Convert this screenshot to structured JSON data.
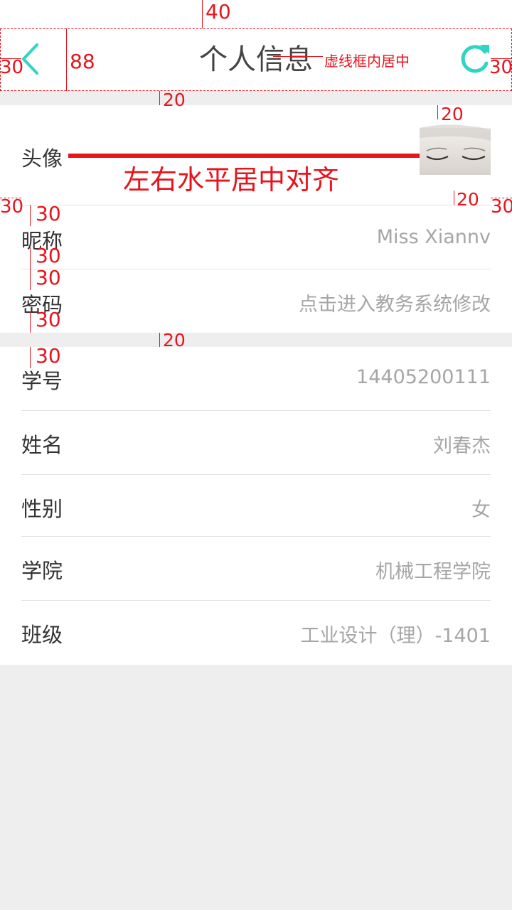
{
  "header": {
    "title": "个人信息",
    "back_icon": "chevron-left-icon",
    "refresh_icon": "refresh-icon",
    "accent": "#2fd4c4"
  },
  "profile": {
    "avatar_label": "头像",
    "nickname_label": "昵称",
    "nickname_value": "Miss Xiannv",
    "password_label": "密码",
    "password_value": "点击进入教务系统修改"
  },
  "info": {
    "student_id_label": "学号",
    "student_id_value": "14405200111",
    "name_label": "姓名",
    "name_value": "刘春杰",
    "gender_label": "性别",
    "gender_value": "女",
    "college_label": "学院",
    "college_value": "机械工程学院",
    "class_label": "班级",
    "class_value": "工业设计（理）-1401"
  },
  "annotations": {
    "top": "40",
    "header_height": "88",
    "left_margin": "30",
    "right_margin": "30",
    "center_note": "虚线框内居中",
    "gap1": "20",
    "avatar_top": "20",
    "avatar_bottom": "20",
    "align_note": "左右水平居中对齐",
    "row_left": "30",
    "row_right": "30",
    "pad_a": "30",
    "pad_b": "30",
    "pad_c": "30",
    "pad_d": "30",
    "gap2": "20",
    "pad_e": "30",
    "annotation_color": "#e8141c"
  }
}
